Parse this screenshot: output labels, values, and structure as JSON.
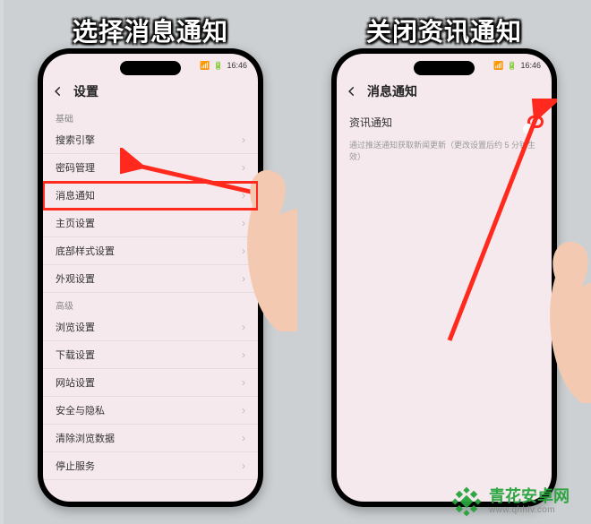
{
  "left": {
    "caption": "选择消息通知",
    "statusTime": "16:46",
    "titlebar": {
      "title": "设置"
    },
    "sections": {
      "basicHeader": "基础",
      "basicRows": [
        {
          "label": "搜索引擎"
        },
        {
          "label": "密码管理"
        },
        {
          "label": "消息通知",
          "highlighted": true
        },
        {
          "label": "主页设置"
        },
        {
          "label": "底部样式设置"
        },
        {
          "label": "外观设置"
        }
      ],
      "advHeader": "高级",
      "advRows": [
        {
          "label": "浏览设置"
        },
        {
          "label": "下载设置"
        },
        {
          "label": "网站设置"
        },
        {
          "label": "安全与隐私"
        },
        {
          "label": "清除浏览数据"
        },
        {
          "label": "停止服务"
        }
      ]
    }
  },
  "right": {
    "caption": "关闭资讯通知",
    "statusTime": "16:46",
    "titlebar": {
      "title": "消息通知"
    },
    "toggleRow": {
      "label": "资讯通知",
      "on": true
    },
    "hint": "通过推送通知获取新闻更新（更改设置后约 5 分钟生效）"
  },
  "watermark": {
    "name": "青花安卓网",
    "url": "www.qhhlv.com"
  }
}
